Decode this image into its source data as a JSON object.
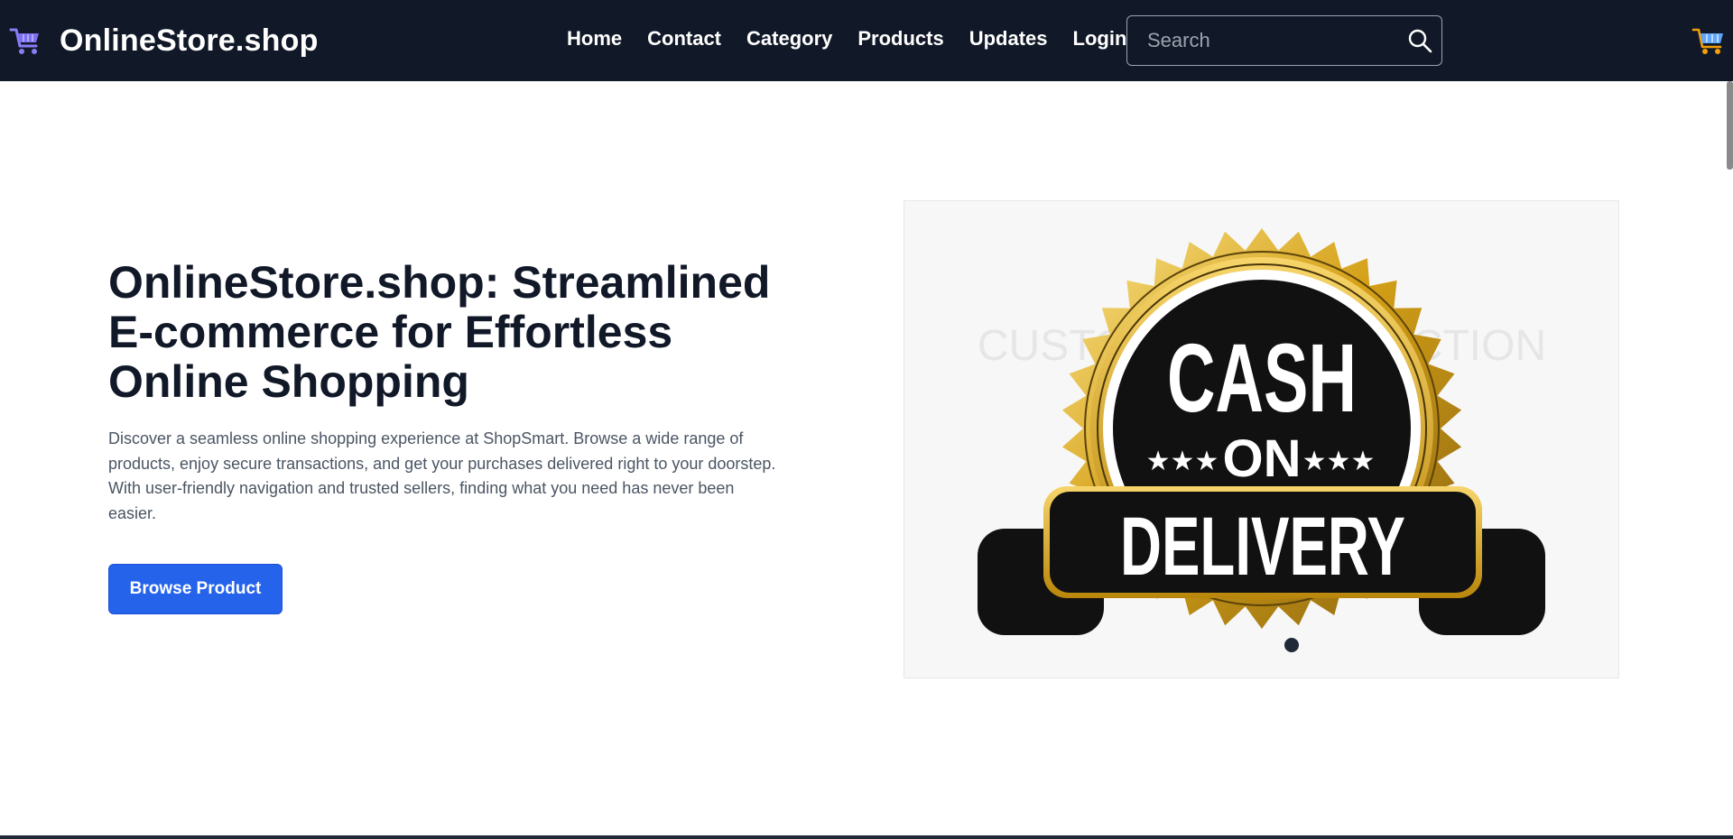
{
  "header": {
    "brand": "OnlineStore.shop",
    "nav": [
      "Home",
      "Contact",
      "Category",
      "Products",
      "Updates",
      "Login"
    ],
    "search_placeholder": "Search"
  },
  "hero": {
    "title": "OnlineStore.shop: Streamlined E-commerce for Effortless Online Shopping",
    "description": "Discover a seamless online shopping experience at ShopSmart. Browse a wide range of products, enjoy secure transactions, and get your purchases delivered right to your doorstep. With user-friendly navigation and trusted sellers, finding what you need has never been easier.",
    "button": "Browse Product"
  },
  "carousel": {
    "badge_line1": "CASH",
    "badge_line2": "ON",
    "badge_line3": "DELIVERY",
    "watermark": "CUSTOMER SATISFACTION",
    "stars_left": "★★★",
    "stars_right": "★★★",
    "active_slide": 1,
    "total_slides": 1
  },
  "icons": {
    "brand_logo": "shopping-cart-icon",
    "search": "search-icon",
    "cart": "cart-icon"
  },
  "colors": {
    "navbar_bg": "#111827",
    "primary_button": "#2563eb",
    "badge_gold": "#d4a017",
    "badge_black": "#111111"
  }
}
